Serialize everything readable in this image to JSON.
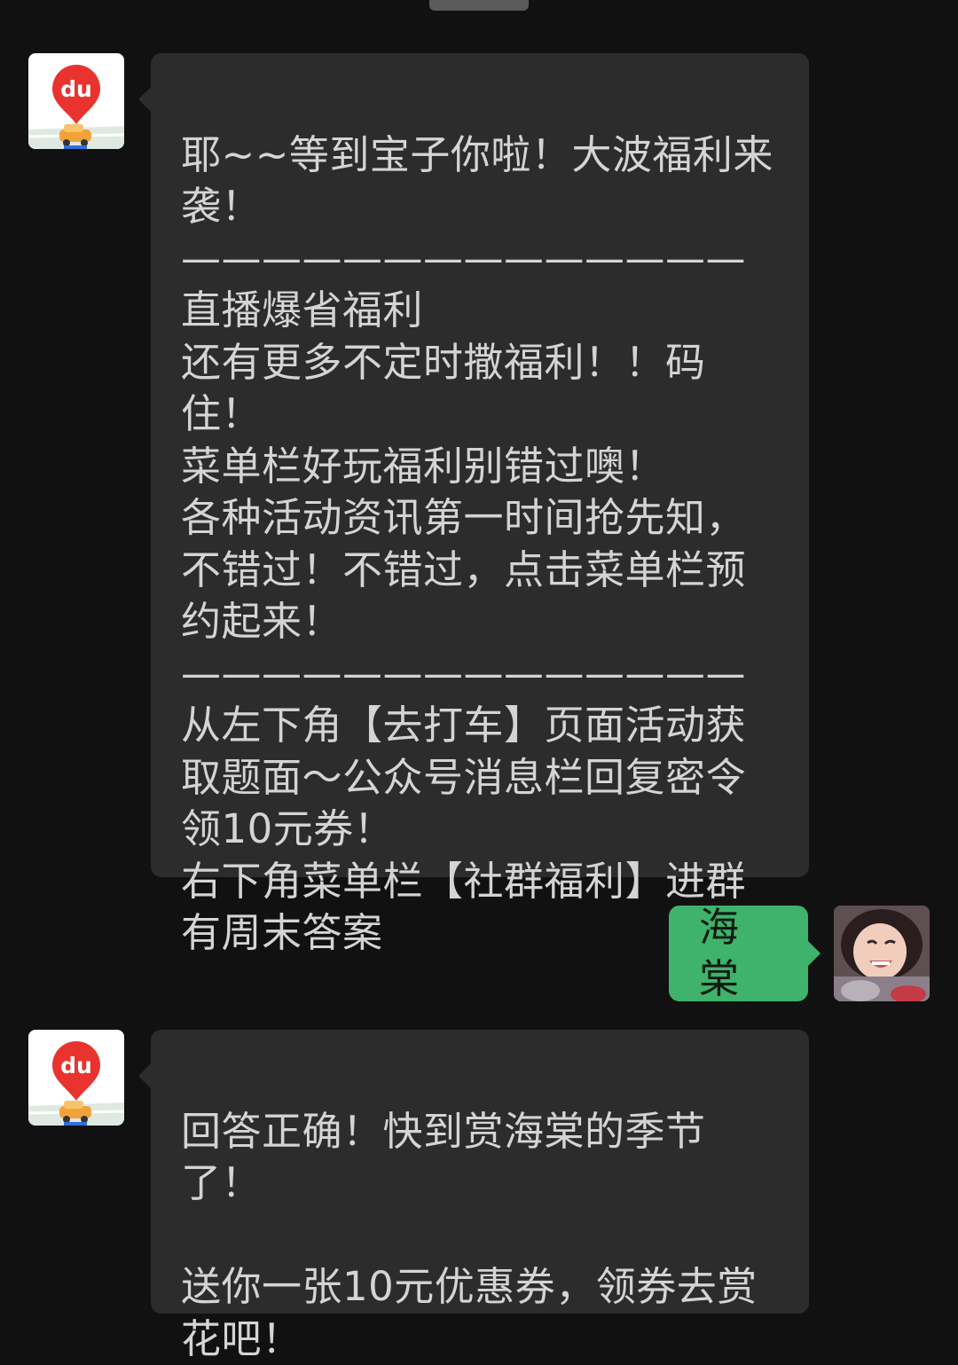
{
  "chat": {
    "messages": [
      {
        "sender": "bot",
        "avatar_icon": "baidu-maps-du-icon",
        "avatar_text": "du",
        "text": "耶~~等到宝子你啦！大波福利来袭！\n——————————————\n直播爆省福利\n还有更多不定时撒福利！！码住！\n菜单栏好玩福利别错过噢！\n各种活动资讯第一时间抢先知，不错过！不错过，点击菜单栏预约起来！\n——————————————\n从左下角【去打车】页面活动获取题面～公众号消息栏回复密令领10元券！\n右下角菜单栏【社群福利】进群有周末答案"
      },
      {
        "sender": "user",
        "avatar_icon": "user-photo-avatar",
        "text": "海棠"
      },
      {
        "sender": "bot",
        "avatar_icon": "baidu-maps-du-icon",
        "avatar_text": "du",
        "text": "回答正确！快到赏海棠的季节了！\n\n送你一张10元优惠券，领券去赏花吧！"
      }
    ]
  },
  "colors": {
    "background": "#111111",
    "incoming_bubble": "#2c2c2c",
    "outgoing_bubble": "#3fb36b",
    "brand_red": "#e8332f"
  }
}
